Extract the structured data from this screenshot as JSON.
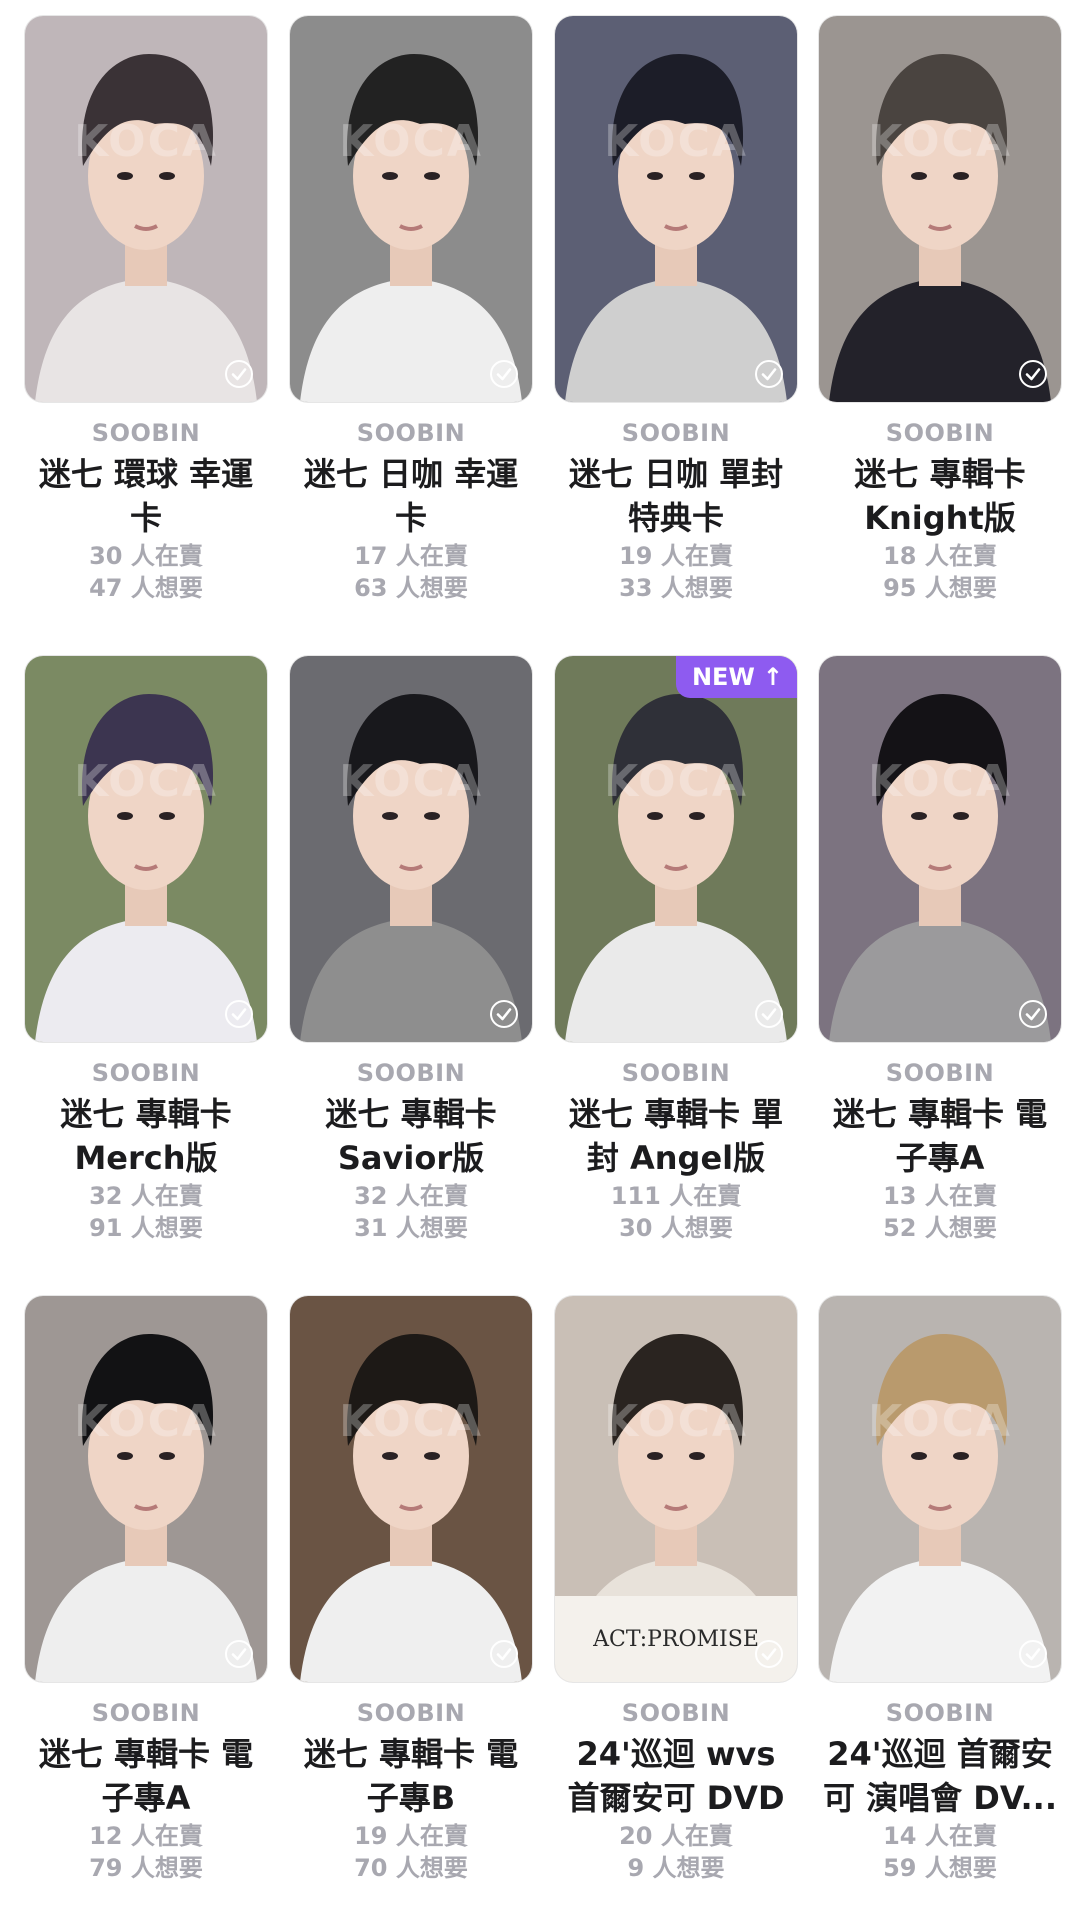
{
  "cards": [
    {
      "member": "SOOBIN",
      "title": "迷七 環球 幸運卡",
      "selling": "30 人在賣",
      "wanting": "47 人想要",
      "colors": [
        "#bfb6b9",
        "#3a3236",
        "#e8e4e4"
      ],
      "checked": true,
      "new": false
    },
    {
      "member": "SOOBIN",
      "title": "迷七 日咖 幸運卡",
      "selling": "17 人在賣",
      "wanting": "63 人想要",
      "colors": [
        "#8c8c8c",
        "#222222",
        "#eeeeee"
      ],
      "checked": true,
      "new": false
    },
    {
      "member": "SOOBIN",
      "title": "迷七 日咖 單封特典卡",
      "selling": "19 人在賣",
      "wanting": "33 人想要",
      "colors": [
        "#5c5f74",
        "#1c1d28",
        "#cfcfcf"
      ],
      "checked": true,
      "new": false
    },
    {
      "member": "SOOBIN",
      "title": "迷七 專輯卡 Knight版",
      "selling": "18 人在賣",
      "wanting": "95 人想要",
      "colors": [
        "#9b9591",
        "#4a4440",
        "#23222a"
      ],
      "checked": true,
      "new": false
    },
    {
      "member": "SOOBIN",
      "title": "迷七 專輯卡 Merch版",
      "selling": "32 人在賣",
      "wanting": "91 人想要",
      "colors": [
        "#7b8a63",
        "#3c3550",
        "#ecebf0"
      ],
      "checked": true,
      "new": false
    },
    {
      "member": "SOOBIN",
      "title": "迷七 專輯卡 Savior版",
      "selling": "32 人在賣",
      "wanting": "31 人想要",
      "colors": [
        "#6b6b70",
        "#18181c",
        "#8e8e8e"
      ],
      "checked": true,
      "new": false
    },
    {
      "member": "SOOBIN",
      "title": "迷七 專輯卡 單封 Angel版",
      "selling": "111 人在賣",
      "wanting": "30 人想要",
      "colors": [
        "#6f7a5a",
        "#2f3038",
        "#eaeaea"
      ],
      "checked": true,
      "new": true
    },
    {
      "member": "SOOBIN",
      "title": "迷七 專輯卡 電子專A",
      "selling": "13 人在賣",
      "wanting": "52 人想要",
      "colors": [
        "#7c7380",
        "#141216",
        "#9b9a9c"
      ],
      "checked": true,
      "new": false
    },
    {
      "member": "SOOBIN",
      "title": "迷七 專輯卡 電子專A",
      "selling": "12 人在賣",
      "wanting": "79 人想要",
      "colors": [
        "#9e9794",
        "#121214",
        "#eeeeee"
      ],
      "checked": true,
      "new": false
    },
    {
      "member": "SOOBIN",
      "title": "迷七 專輯卡 電子專B",
      "selling": "19 人在賣",
      "wanting": "70 人想要",
      "colors": [
        "#6a5444",
        "#1d1916",
        "#efefef"
      ],
      "checked": true,
      "new": false
    },
    {
      "member": "SOOBIN",
      "title": "24'巡迴 wvs 首爾安可 DVD ...",
      "selling": "20 人在賣",
      "wanting": "9 人想要",
      "colors": [
        "#c9bfb6",
        "#2a2420",
        "#e8e2da"
      ],
      "checked": true,
      "new": false
    },
    {
      "member": "SOOBIN",
      "title": "24'巡迴 首爾安可 演唱會 DV...",
      "selling": "14 人在賣",
      "wanting": "59 人想要",
      "colors": [
        "#b9b4b0",
        "#b99a6d",
        "#f2f2f2"
      ],
      "checked": true,
      "new": false
    }
  ],
  "watermark": "KOCA",
  "new_badge": {
    "label": "NEW",
    "arrow": "↑"
  },
  "check_icon": "check-circle-icon",
  "card_poster_text": "ACT:PROMISE"
}
